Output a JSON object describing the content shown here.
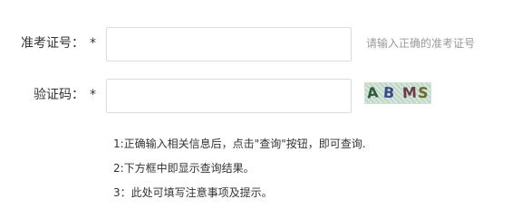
{
  "form": {
    "exam_id": {
      "label": "准考证号：",
      "required_mark": "*",
      "value": "",
      "hint": "请输入正确的准考证号"
    },
    "captcha": {
      "label": "验证码：",
      "required_mark": "*",
      "value": "",
      "image_text": [
        "A",
        "B",
        "M",
        "S"
      ]
    }
  },
  "notes": [
    "1:正确输入相关信息后，点击\"查询\"按钮，即可查询.",
    "2:下方框中即显示查询结果。",
    "3：此处可填写注意事项及提示。"
  ]
}
